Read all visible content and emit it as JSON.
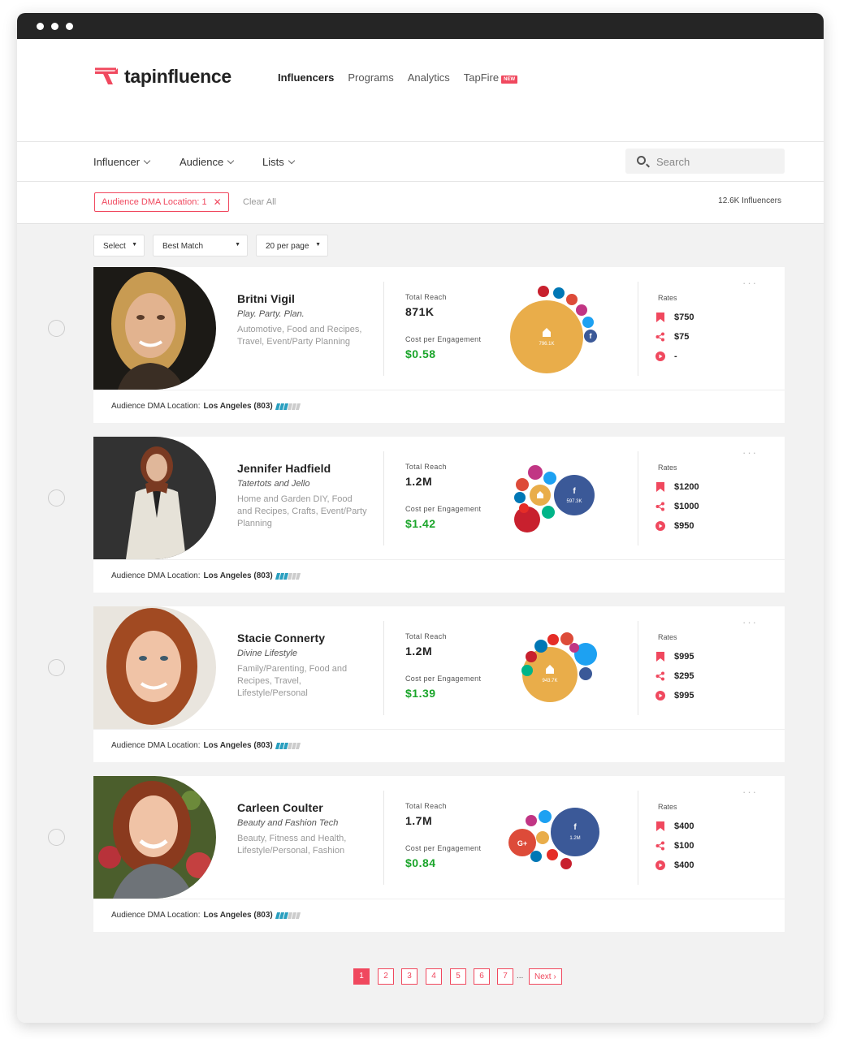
{
  "app": {
    "name": "tapinfluence"
  },
  "nav": {
    "items": [
      {
        "label": "Influencers",
        "active": true
      },
      {
        "label": "Programs",
        "active": false
      },
      {
        "label": "Analytics",
        "active": false
      },
      {
        "label": "TapFire",
        "active": false,
        "badge": "NEW"
      }
    ]
  },
  "filters": {
    "items": [
      "Influencer",
      "Audience",
      "Lists"
    ],
    "search_placeholder": "Search"
  },
  "chips": {
    "active_filter": "Audience DMA Location: 1",
    "clear_label": "Clear All",
    "result_count": "12.6K Influencers"
  },
  "controls": {
    "select": "Select",
    "sort": "Best Match",
    "per_page": "20 per page"
  },
  "labels": {
    "total_reach": "Total Reach",
    "cost_per_engagement": "Cost per Engagement",
    "rates": "Rates",
    "audience_dma": "Audience DMA Location:",
    "more": "···"
  },
  "influencers": [
    {
      "name": "Britni Vigil",
      "tagline": "Play. Party. Plan.",
      "categories": "Automotive, Food and Recipes, Travel, Event/Party Planning",
      "total_reach": "871K",
      "cpe": "$0.58",
      "main_bubble_value": "796.1K",
      "rates": [
        "$750",
        "$75",
        "-"
      ],
      "dma": "Los Angeles (803)"
    },
    {
      "name": "Jennifer Hadfield",
      "tagline": "Tatertots and Jello",
      "categories": "Home and Garden DIY, Food and Recipes, Crafts, Event/Party Planning",
      "total_reach": "1.2M",
      "cpe": "$1.42",
      "main_bubble_value": "597.3K",
      "rates": [
        "$1200",
        "$1000",
        "$950"
      ],
      "dma": "Los Angeles (803)"
    },
    {
      "name": "Stacie Connerty",
      "tagline": "Divine Lifestyle",
      "categories": "Family/Parenting, Food and Recipes, Travel, Lifestyle/Personal",
      "total_reach": "1.2M",
      "cpe": "$1.39",
      "main_bubble_value": "943.7K",
      "rates": [
        "$995",
        "$295",
        "$995"
      ],
      "dma": "Los Angeles (803)"
    },
    {
      "name": "Carleen Coulter",
      "tagline": "Beauty and Fashion Tech",
      "categories": "Beauty, Fitness and Health, Lifestyle/Personal, Fashion",
      "total_reach": "1.7M",
      "cpe": "$0.84",
      "main_bubble_value": "1.2M",
      "rates": [
        "$400",
        "$100",
        "$400"
      ],
      "dma": "Los Angeles (803)"
    }
  ],
  "pagination": {
    "pages": [
      "1",
      "2",
      "3",
      "4",
      "5",
      "6",
      "7"
    ],
    "current": "1",
    "ellipsis": "...",
    "next": "Next ›"
  },
  "colors": {
    "accent": "#f0485e",
    "cpe_green": "#1aa52a",
    "blog": "#e9ad4a",
    "facebook": "#3b5998",
    "pinterest": "#c8202e",
    "twitter": "#1da1f2",
    "google": "#dd4b39",
    "instagram": "#c13584",
    "linkedin": "#0077b5",
    "youtube": "#e52d27",
    "vine": "#00b488"
  }
}
